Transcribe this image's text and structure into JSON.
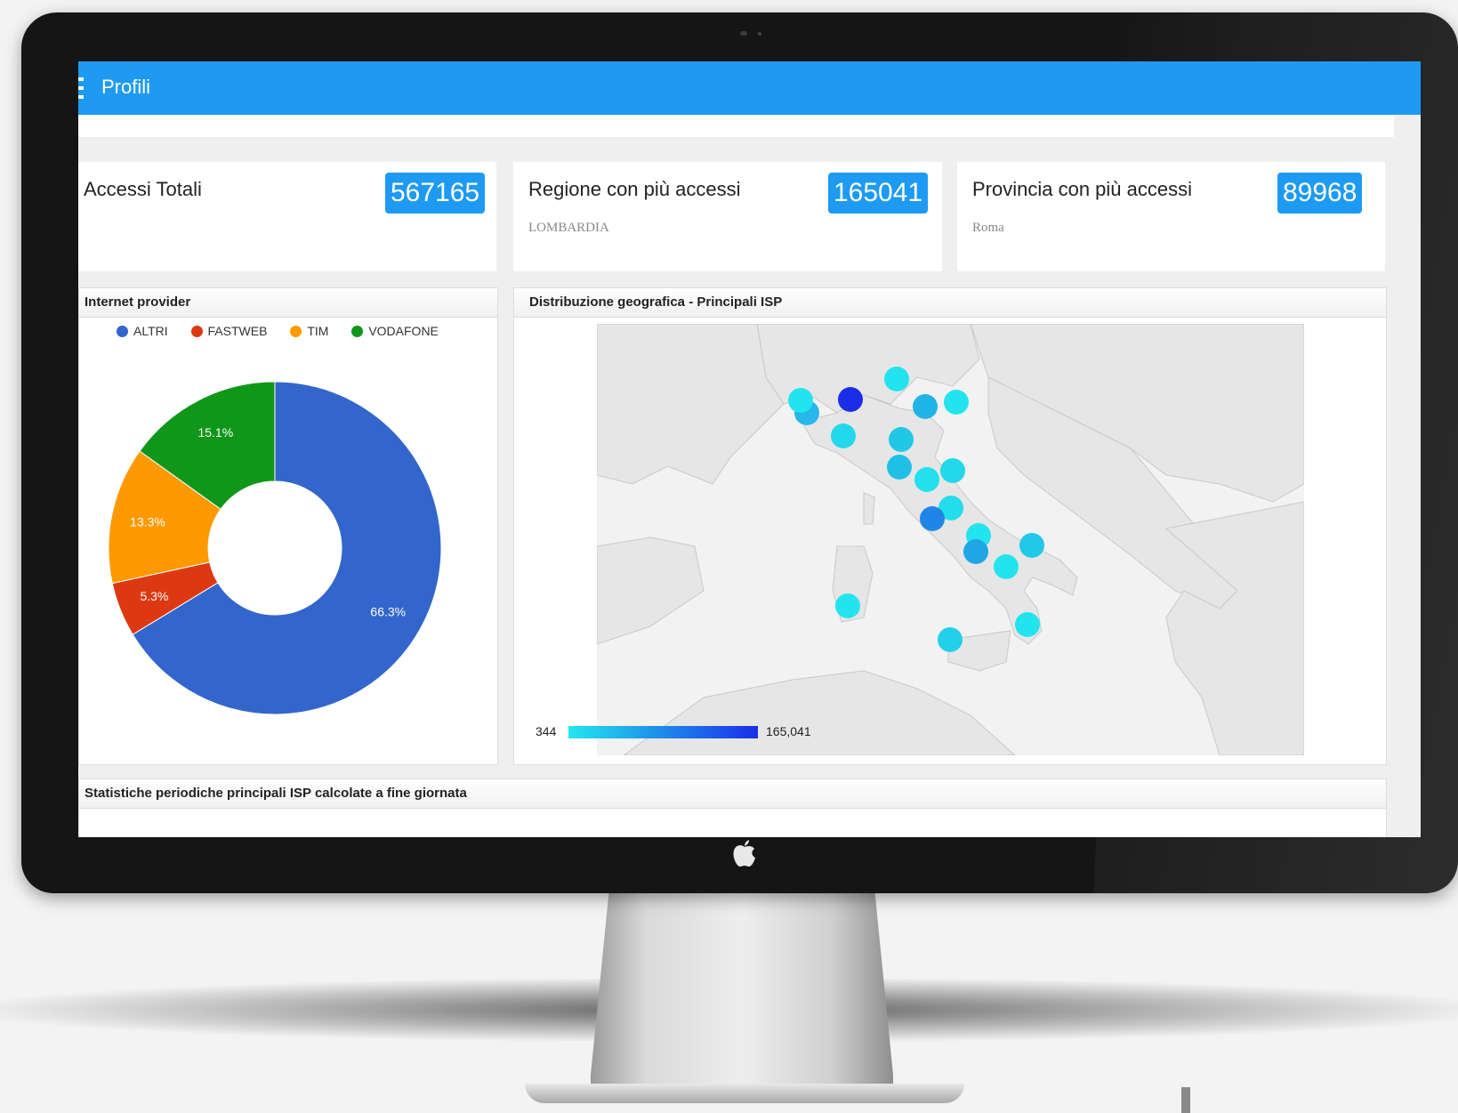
{
  "app": {
    "title": "Profili"
  },
  "kpis": [
    {
      "title": "Accessi Totali",
      "value": "567165",
      "subtitle": ""
    },
    {
      "title": "Regione con più accessi",
      "value": "165041",
      "subtitle": "LOMBARDIA"
    },
    {
      "title": "Provincia con più accessi",
      "value": "89968",
      "subtitle": "Roma"
    }
  ],
  "panels": {
    "isp": "Internet provider",
    "geo": "Distribuzione geografica - Principali ISP",
    "stats": "Statistiche periodiche principali ISP calcolate a fine giornata"
  },
  "chart_data": [
    {
      "type": "pie",
      "subtype": "donut",
      "title": "Internet provider",
      "categories": [
        "ALTRI",
        "FASTWEB",
        "TIM",
        "VODAFONE"
      ],
      "values": [
        66.3,
        5.3,
        13.3,
        15.1
      ],
      "value_labels": [
        "66.3%",
        "5.3%",
        "13.3%",
        "15.1%"
      ],
      "colors": [
        "#3366cc",
        "#dc3912",
        "#ff9900",
        "#109618"
      ],
      "legend": "top"
    },
    {
      "type": "scatter",
      "subtype": "geo-bubble-map",
      "title": "Distribuzione geografica - Principali ISP",
      "region": "Italia",
      "color_scale": {
        "min_label": "344",
        "max_label": "165,041",
        "min_color": "#23e6ee",
        "max_color": "#1a2ee8"
      }
    }
  ]
}
